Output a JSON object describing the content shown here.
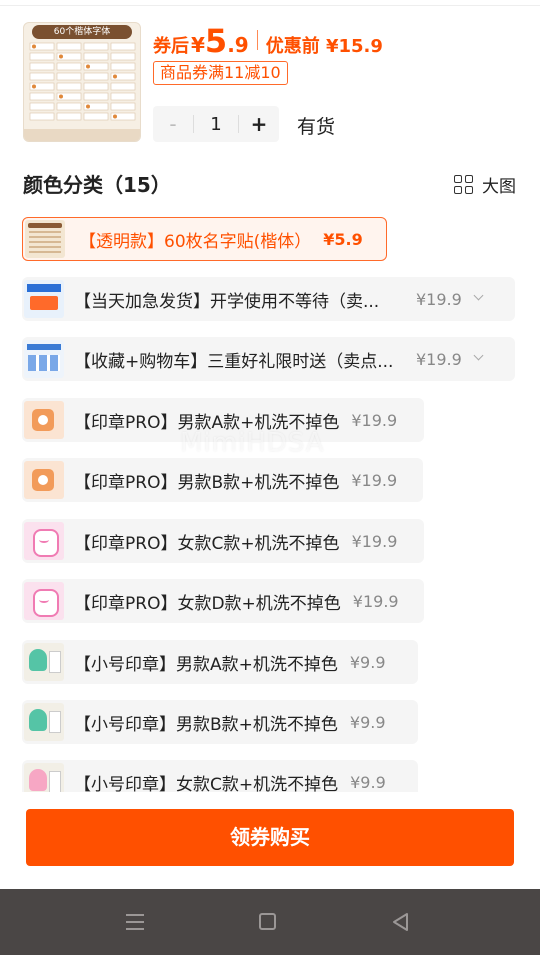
{
  "product": {
    "thumb_title": "60个楷体字体",
    "price_prefix": "券后",
    "price_yen": "¥",
    "price_int": "5",
    "price_dec": ".9",
    "orig_price_label": "优惠前 ¥15.9",
    "coupon": "商品券满11减10",
    "accent_color": "#ff5000"
  },
  "quantity": {
    "minus": "-",
    "value": "1",
    "plus": "+",
    "stock": "有货"
  },
  "section": {
    "title": "颜色分类（15）",
    "bigview_label": "大图",
    "bigview_icon": "grid-icon"
  },
  "options": [
    {
      "label": "【透明款】60枚名字贴(楷体）",
      "price": "¥5.9",
      "selected": true
    },
    {
      "label": "【当天加急发货】开学使用不等待（卖...",
      "price": "¥19.9",
      "chevron": true
    },
    {
      "label": "【收藏+购物车】三重好礼限时送（卖点...",
      "price": "¥19.9",
      "chevron": true
    },
    {
      "label": "【印章PRO】男款A款+机洗不掉色",
      "price": "¥19.9"
    },
    {
      "label": "【印章PRO】男款B款+机洗不掉色",
      "price": "¥19.9"
    },
    {
      "label": "【印章PRO】女款C款+机洗不掉色",
      "price": "¥19.9"
    },
    {
      "label": "【印章PRO】女款D款+机洗不掉色",
      "price": "¥19.9"
    },
    {
      "label": "【小号印章】男款A款+机洗不掉色",
      "price": "¥9.9"
    },
    {
      "label": "【小号印章】男款B款+机洗不掉色",
      "price": "¥9.9"
    },
    {
      "label": "【小号印章】女款C款+机洗不掉色",
      "price": "¥9.9"
    }
  ],
  "watermark": "MimiHDSA",
  "buy_button": "领券购买",
  "navbar": {
    "menu_icon": "menu-icon",
    "home_icon": "home-square-icon",
    "back_icon": "back-triangle-icon"
  }
}
